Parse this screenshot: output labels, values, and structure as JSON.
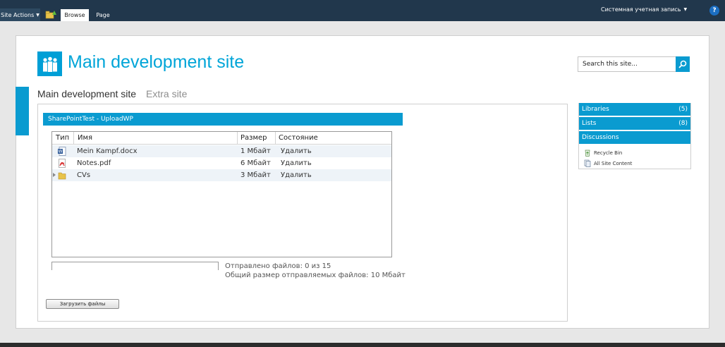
{
  "ribbon": {
    "site_actions": "Site Actions",
    "tabs": [
      {
        "label": "Browse",
        "active": true
      },
      {
        "label": "Page",
        "active": false
      }
    ],
    "user": "Системная учетная запись",
    "help": "?"
  },
  "header": {
    "title": "Main development site",
    "search_placeholder": "Search this site..."
  },
  "topnav": [
    {
      "label": "Main development site",
      "active": true
    },
    {
      "label": "Extra site",
      "active": false
    }
  ],
  "webpart": {
    "title": "SharePointTest - UploadWP",
    "columns": [
      "Тип",
      "Имя",
      "Размер",
      "Состояние"
    ],
    "files": [
      {
        "type_icon": "word-document-icon",
        "name": "Mein Kampf.docx",
        "size": "1 Мбайт",
        "action": "Удалить"
      },
      {
        "type_icon": "pdf-file-icon",
        "name": "Notes.pdf",
        "size": "6 Мбайт",
        "action": "Удалить"
      },
      {
        "type_icon": "folder-icon",
        "name": "CVs",
        "size": "3 Мбайт",
        "action": "Удалить"
      }
    ],
    "sent_status": "Отправлено файлов: 0 из 15",
    "total_size": "Общий размер отправляемых файлов: 10 Мбайт",
    "upload_progress": 0,
    "upload_button": "Загрузить файлы"
  },
  "quicklaunch": {
    "headings": [
      {
        "label": "Libraries",
        "count": "(5)"
      },
      {
        "label": "Lists",
        "count": "(8)"
      },
      {
        "label": "Discussions",
        "count": ""
      }
    ],
    "links": [
      {
        "label": "Recycle Bin",
        "icon": "recycle-bin-icon"
      },
      {
        "label": "All Site Content",
        "icon": "site-content-icon"
      }
    ]
  },
  "colors": {
    "ribbon": "#21374c",
    "accent": "#0a9bd0",
    "title": "#00a5d8"
  }
}
